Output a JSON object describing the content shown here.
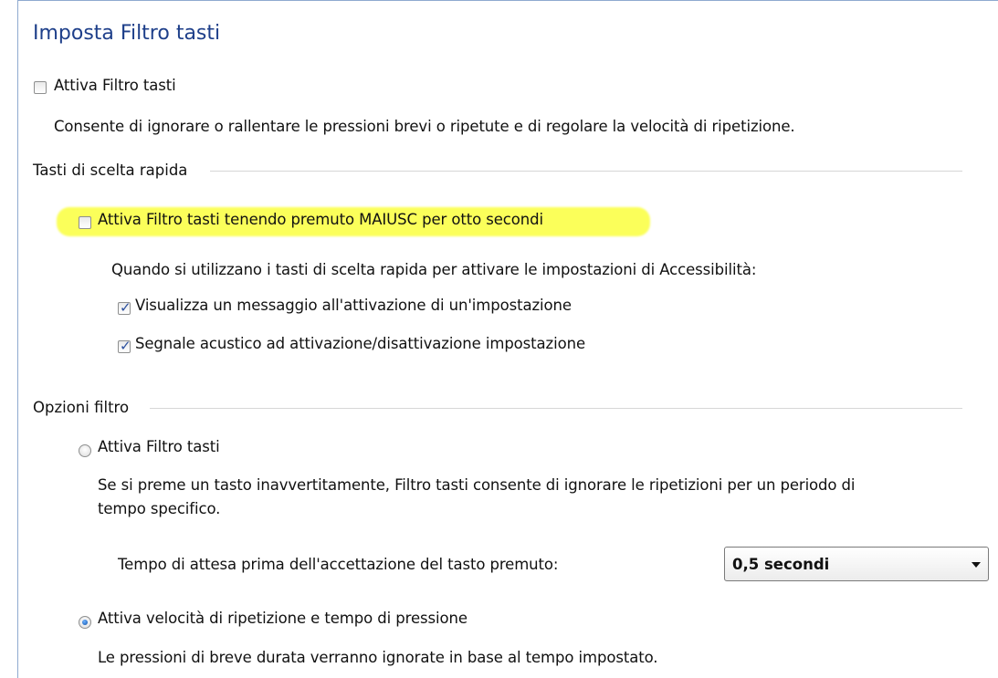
{
  "title": "Imposta Filtro tasti",
  "main": {
    "enable_filter_label": "Attiva Filtro tasti",
    "enable_filter_checked": false,
    "enable_filter_desc": "Consente di ignorare o rallentare le pressioni brevi o ripetute e di regolare la velocità di ripetizione."
  },
  "shortcuts": {
    "group_label": "Tasti di scelta rapida",
    "shift_label": "Attiva Filtro tasti tenendo premuto MAIUSC per otto secondi",
    "shift_checked": false,
    "intro": "Quando si utilizzano i tasti di scelta rapida per attivare le impostazioni di Accessibilità:",
    "show_message_label": "Visualizza un messaggio all'attivazione di un'impostazione",
    "show_message_checked": true,
    "beep_label": "Segnale acustico ad attivazione/disattivazione impostazione",
    "beep_checked": true,
    "highlight_color": "#fbff5a"
  },
  "filter_options": {
    "group_label": "Opzioni filtro",
    "bounce_label": "Attiva Filtro tasti",
    "bounce_selected": false,
    "bounce_desc_line1": "Se si preme un tasto inavvertitamente, Filtro tasti consente di ignorare le ripetizioni per un periodo di",
    "bounce_desc_line2": "tempo specifico.",
    "wait_label": "Tempo di attesa prima dell'accettazione del tasto premuto:",
    "wait_value": "0,5 secondi",
    "repeat_label": "Attiva velocità di ripetizione e tempo di pressione",
    "repeat_selected": true,
    "repeat_desc": "Le pressioni di breve durata verranno ignorate in base al tempo impostato."
  },
  "colors": {
    "title": "#1e3f8a",
    "check_tick": "#2b4f9e",
    "separator": "#d6d6d6"
  }
}
